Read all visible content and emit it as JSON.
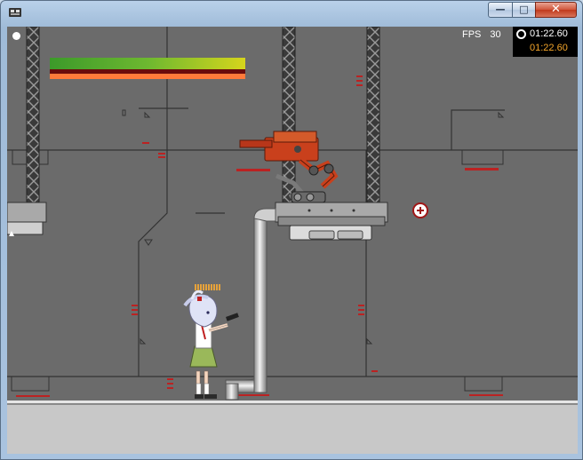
{
  "window": {
    "title": "",
    "controls": {
      "minimize": "—",
      "maximize": "□",
      "close": "✕"
    }
  },
  "hud": {
    "fps_label": "FPS",
    "fps_value": "30",
    "timer_current": "01:22.60",
    "timer_best": "01:22.60",
    "health_fraction": 1.0,
    "ammo_count": 10
  },
  "colors": {
    "background_wall": "#6b6b6b",
    "floor": "#c8c8c8",
    "enemy": "#c9401c",
    "timer_best": "#f4a52a",
    "health_bar_top": "#3a9a2a",
    "health_bar_low": "#ff7a3a"
  },
  "icons": {
    "app": "game-app-icon",
    "clock": "clock-icon",
    "crosshair": "crosshair-icon"
  }
}
